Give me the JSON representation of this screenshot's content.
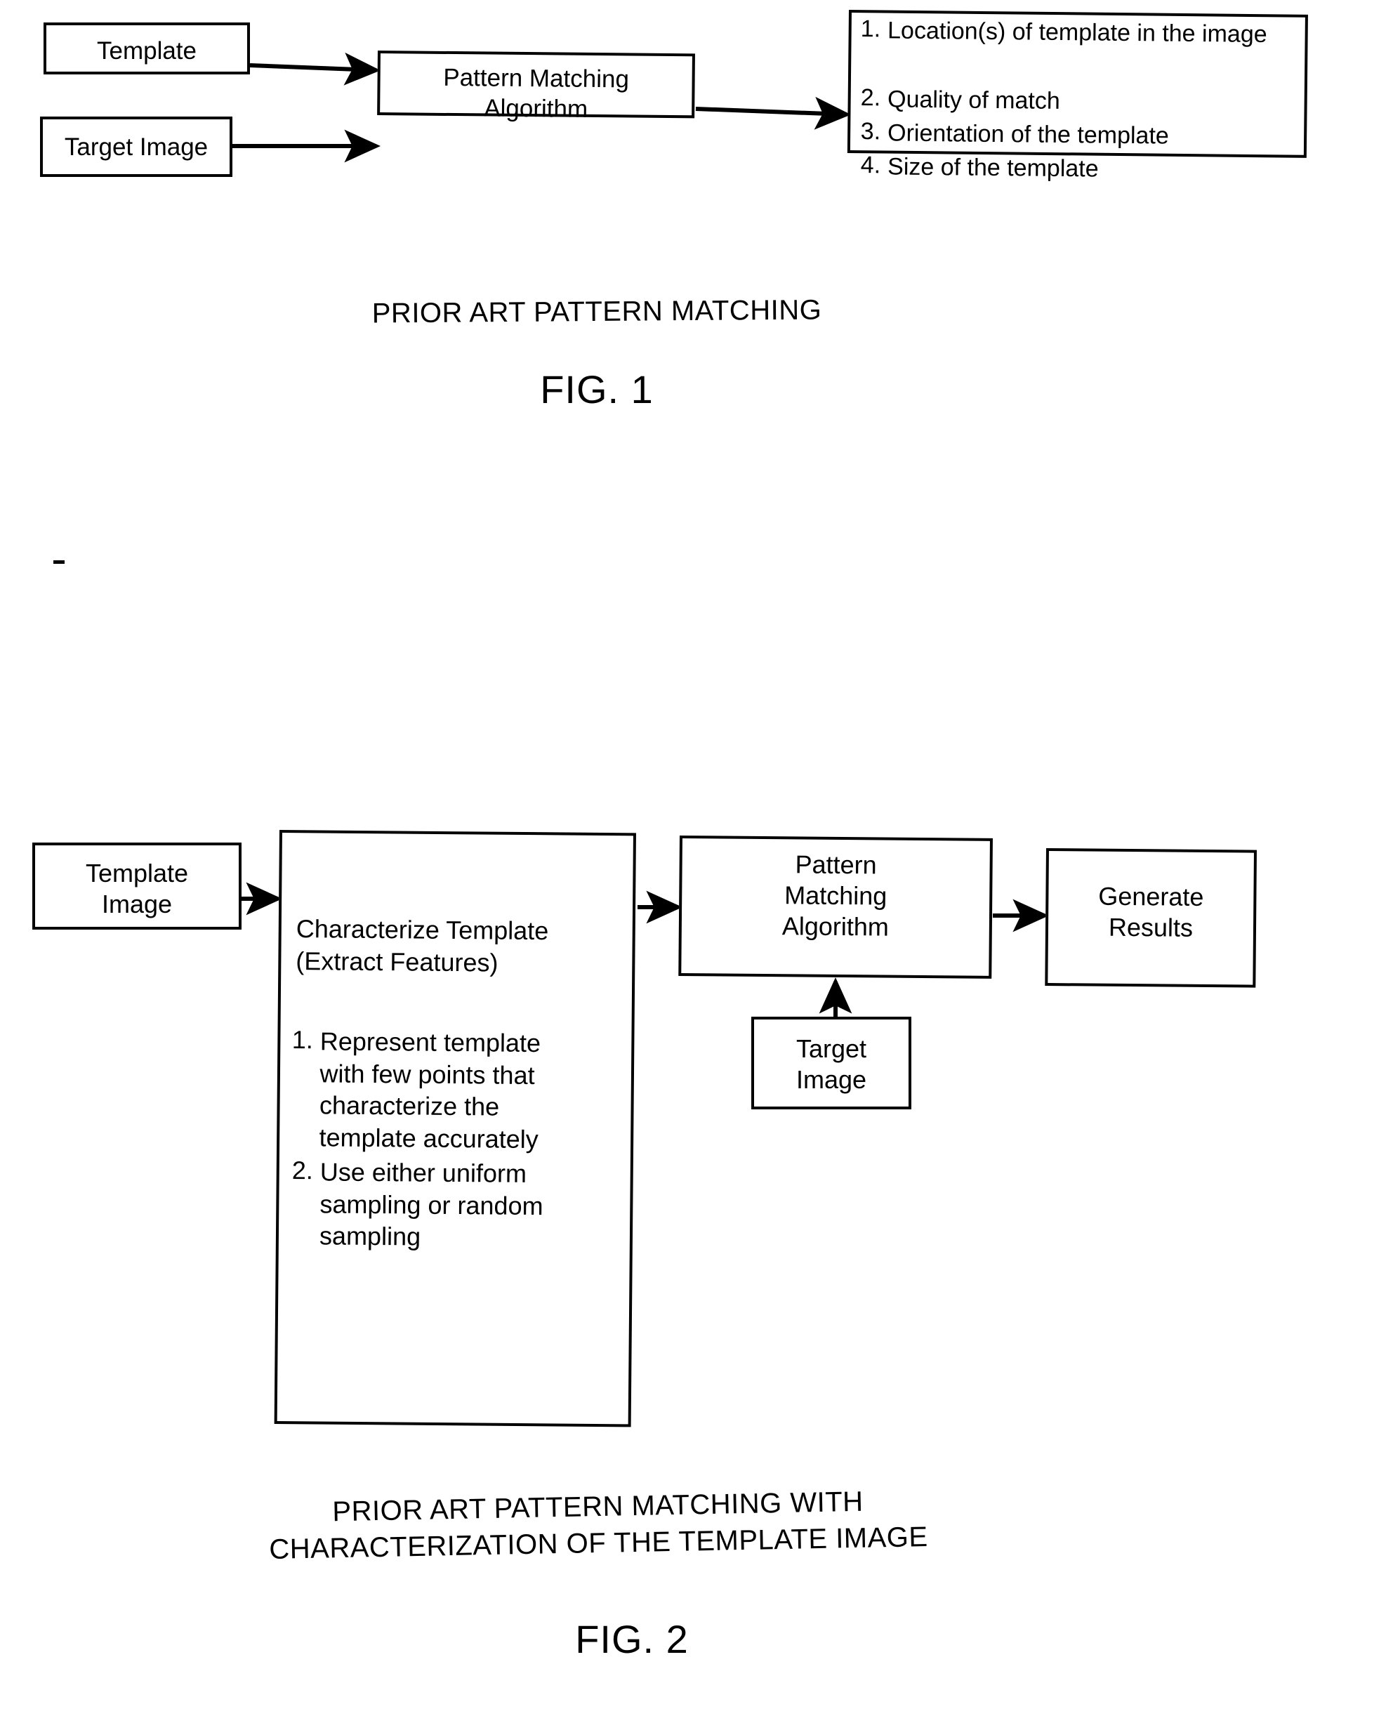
{
  "document": {
    "kind": "patent-figure-sheet",
    "figures": [
      {
        "id": "fig1",
        "caption": "PRIOR ART PATTERN MATCHING",
        "label": "FIG. 1",
        "nodes": [
          {
            "id": "template",
            "label": "Template"
          },
          {
            "id": "target_image",
            "label": "Target Image"
          },
          {
            "id": "pattern_matching_algorithm",
            "label": "Pattern  Matching\nAlgorithm"
          },
          {
            "id": "results",
            "label": ""
          }
        ],
        "results_list": [
          {
            "num": "1.",
            "text": "Location(s) of template in the image"
          },
          {
            "num": "2.",
            "text": "Quality of match"
          },
          {
            "num": "3.",
            "text": "Orientation of the template"
          },
          {
            "num": "4.",
            "text": "Size of the template"
          }
        ]
      },
      {
        "id": "fig2",
        "caption": "PRIOR ART PATTERN MATCHING WITH\nCHARACTERIZATION OF THE TEMPLATE IMAGE",
        "label": "FIG. 2",
        "nodes": [
          {
            "id": "template_image",
            "label": "Template\nImage"
          },
          {
            "id": "characterize_template",
            "title": "Characterize Template\n(Extract Features)"
          },
          {
            "id": "pattern_matching_algorithm",
            "label": "Pattern\nMatching\nAlgorithm"
          },
          {
            "id": "generate_results",
            "label": "Generate\nResults"
          },
          {
            "id": "target_image",
            "label": "Target\nImage"
          }
        ],
        "characterize_list": [
          {
            "num": "1.",
            "text": "Represent template\nwith few points that\ncharacterize the\ntemplate accurately"
          },
          {
            "num": "2.",
            "text": "Use either uniform\nsampling or random\nsampling"
          }
        ]
      }
    ]
  }
}
